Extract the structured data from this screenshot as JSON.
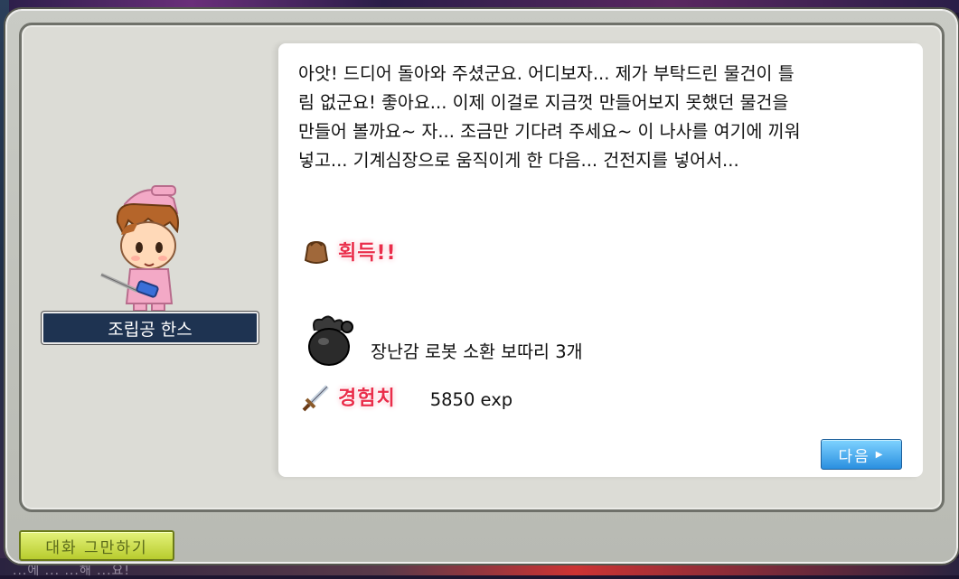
{
  "npc": {
    "name": "조립공 한스"
  },
  "dialog": {
    "text": "아앗! 드디어 돌아와 주셨군요. 어디보자... 제가 부탁드린 물건이 틀\n림 없군요! 좋아요... 이제 이걸로 지금껏 만들어보지 못했던 물건을\n만들어 볼까요~ 자... 조금만 기다려 주세요~ 이 나사를 여기에 끼워\n넣고... 기계심장으로 움직이게 한 다음... 건전지를 넣어서..."
  },
  "rewards": {
    "acquire_label": "획득!!",
    "item": {
      "name": "장난감 로봇 소환 보따리 3개",
      "icon": "item-bag-icon"
    },
    "exp": {
      "label": "경험치",
      "value": "5850 exp",
      "icon": "sword-icon"
    }
  },
  "buttons": {
    "next_label": "다음",
    "end_chat_label": "대화 그만하기"
  },
  "background": {
    "bottom_text": "...에 ... ...해 ...요!"
  },
  "colors": {
    "reward_label": "#ea2d4a",
    "next_button": "#2a8fe0",
    "end_button": "#b8cc2e",
    "nameplate": "#1e3351"
  }
}
